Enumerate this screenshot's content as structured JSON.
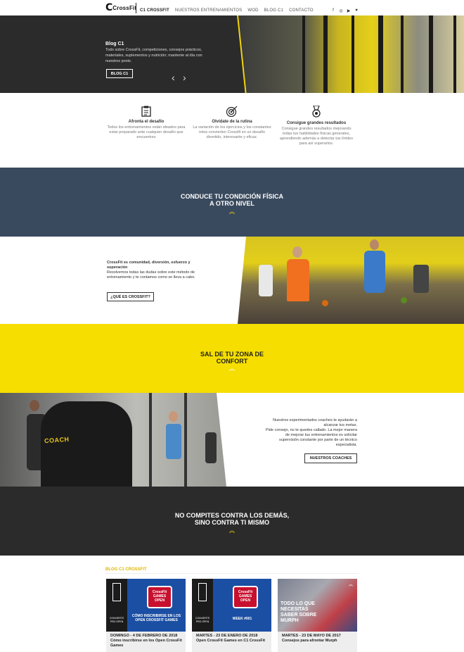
{
  "brand": {
    "logo_c": "C",
    "logo_text": "CrossFit"
  },
  "nav": {
    "items": [
      "C1 CROSSFIT",
      "NUESTROS ENTRENAMIENTOS",
      "WOD",
      "BLOG C1",
      "CONTACTO"
    ],
    "social": [
      "f",
      "◎",
      "▶",
      "♥"
    ]
  },
  "hero": {
    "title": "Blog C1",
    "text": "Todo sobre CrossFit, competiciones, consejos prácticos, materiales, suplementos y nutrición; mantente al día con nuestros posts.",
    "button": "BLOG C1",
    "prev": "‹",
    "next": "›"
  },
  "features": [
    {
      "icon": "clipboard-icon",
      "title": "Afronta el desafío",
      "text": "Todos los entrenamientos están ideados para estar preparado ante cualquier desafío que encuentres"
    },
    {
      "icon": "target-icon",
      "title": "Olvídate de la rutina",
      "text": "La variación de los ejercicios y los constantes retos convierten Crossfit en un desafío divertido, interesante y eficaz."
    },
    {
      "icon": "medal-icon",
      "title": "Consigue grandes resultados",
      "text": "Consigue grandes resultados mejorando todas tus habilidades físicas generales, aprendiendo además a detectar tus límites para así superarlos."
    }
  ],
  "banner1": {
    "line1": "CONDUCE TU CONDICIÓN FÍSICA",
    "line2": "A OTRO NIVEL",
    "chevron": "︽"
  },
  "section1": {
    "heading": "CrossFit es comunidad, diversión, esfuerzo y superación",
    "text": "Resolvemos todas las dudas sobre este método de entrenamiento y te contamos como se lleva a cabo.",
    "button": "¿QUÉ ES CROSSFIT?"
  },
  "banner2": {
    "line1": "SAL DE TU ZONA DE",
    "line2": "CONFORT",
    "chevron": "︽"
  },
  "section2": {
    "heading": "Nuestros experimentados coaches te ayudarán a alcanzar tus metas.",
    "text": "Pide consejo, no te quedes callado. La mejor manera de mejorar tus entrenamientos es solicitar supervisión constante por parte de un técnico especialista.",
    "button": "NUESTROS COACHES",
    "shirt_text": "COACH"
  },
  "banner3": {
    "line1": "NO COMPITES CONTRA LOS DEMÁS,",
    "line2": "SINO CONTRA TI MISMO",
    "chevron": "︽"
  },
  "blog": {
    "heading": "BLOG C1 CROSSFIT",
    "cards": [
      {
        "date": "DOMINGO - 4 DE FEBRERO DE 2018",
        "title": "Cómo inscribirse en los Open CrossFit Games",
        "badge_l1": "CrossFit",
        "badge_l2": "GAMES",
        "badge_l3": "OPEN",
        "caption": "CÓMO INSCRIBIRSE EN LOS OPEN CROSSFIT GAMES",
        "side": "CONVIERTE PRO OPEN"
      },
      {
        "date": "MARTES - 23 DE ENERO DE 2018",
        "title": "Open CrossFit Games en C1 CrossFit",
        "badge_l1": "CrossFit",
        "badge_l2": "GAMES",
        "badge_l3": "OPEN",
        "caption": "WEEK #001",
        "side": "CONVIERTE PRO OPEN"
      },
      {
        "date": "MARTES - 23 DE MAYO DE 2017",
        "title": "Consejos para afrontar Murph",
        "caption": "TODO LO QUE NECESITAS SABER SOBRE MURPH"
      }
    ]
  },
  "colors": {
    "accent": "#f1d40a",
    "dark": "#2b2b2b",
    "navy": "#3a4a5e"
  }
}
